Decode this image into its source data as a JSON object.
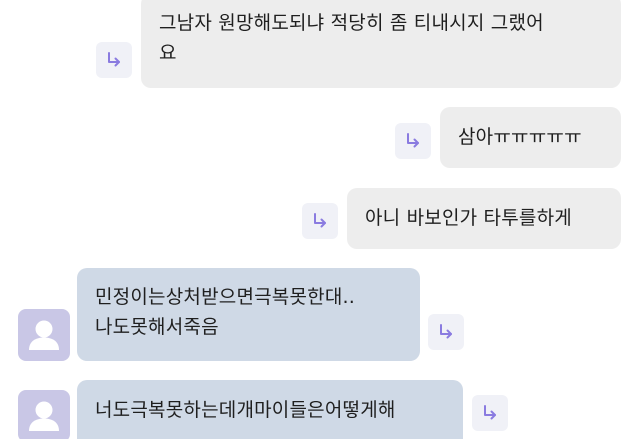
{
  "chat": {
    "messages": [
      {
        "sender": "me",
        "text": "그남자 원망해도되냐 적당히 좀 티내시지 그랬어\n요"
      },
      {
        "sender": "me",
        "text": "삼아ㅠㅠㅠㅠㅠ"
      },
      {
        "sender": "me",
        "text": "아니 바보인가 타투를하게"
      },
      {
        "sender": "other",
        "text": "민정이는상처받으면극복못한대..\n나도못해서죽음"
      },
      {
        "sender": "other",
        "text": "너도극복못하는데개마이들은어떻게해"
      }
    ]
  },
  "icons": {
    "reply": "reply-arrow-icon",
    "avatar": "default-user-avatar-icon"
  },
  "colors": {
    "outgoing_bubble": "#ededed",
    "incoming_bubble": "#cfd9e6",
    "avatar_bg": "#c9c7e6",
    "reply_btn_bg": "#f0f1f7",
    "reply_icon": "#8a7be0"
  }
}
